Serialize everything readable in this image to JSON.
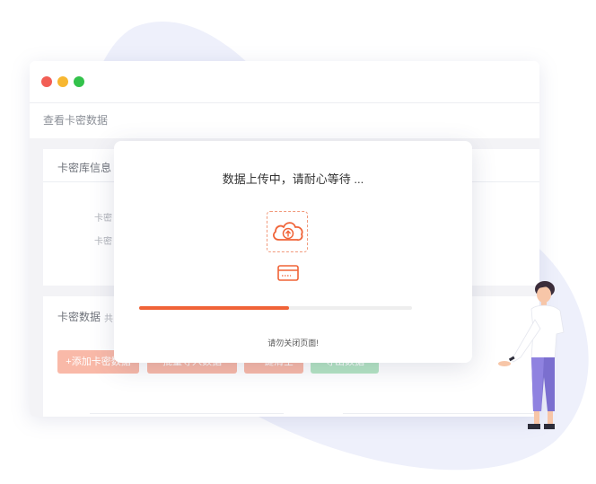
{
  "colors": {
    "accent": "#f06337",
    "blob": "#eef0fb",
    "dot_red": "#f25e55",
    "dot_yellow": "#f7b731",
    "dot_green": "#33c24b"
  },
  "window": {
    "page_title": "查看卡密数据",
    "card1": {
      "title": "卡密库信息",
      "field1_label": "卡密",
      "field2_label": "卡密"
    },
    "card2": {
      "title": "卡密数据",
      "subtitle": "共",
      "buttons": [
        {
          "label": "+添加卡密数据"
        },
        {
          "label": "批量导入数据"
        },
        {
          "label": "一键清空"
        },
        {
          "label": "导出数据"
        }
      ]
    }
  },
  "modal": {
    "title": "数据上传中，请耐心等待 ...",
    "note": "请勿关闭页面!",
    "progress": 0.55,
    "upload_icon": "cloud-upload-icon",
    "card_icon": "credit-card-icon"
  },
  "illustration": {
    "figure": "standing-person"
  }
}
